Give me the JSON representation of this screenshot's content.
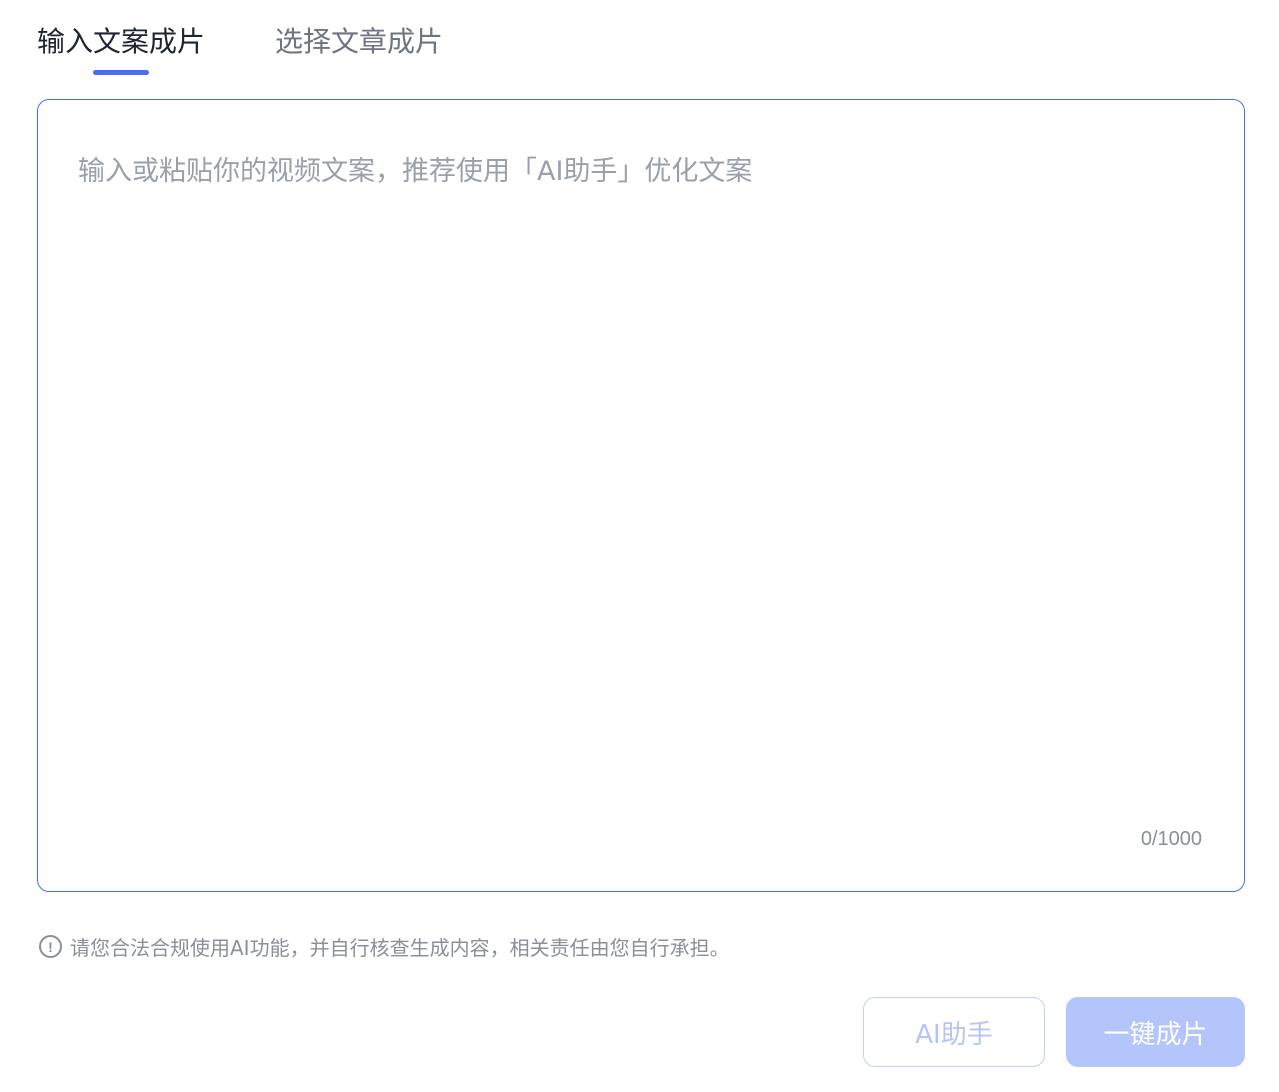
{
  "tabs": [
    {
      "label": "输入文案成片",
      "active": true
    },
    {
      "label": "选择文章成片",
      "active": false
    }
  ],
  "editor": {
    "placeholder": "输入或粘贴你的视频文案，推荐使用「AI助手」优化文案",
    "value": "",
    "counter": "0/1000"
  },
  "notice": {
    "icon": "info-icon",
    "text": "请您合法合规使用AI功能，并自行核查生成内容，相关责任由您自行承担。"
  },
  "buttons": {
    "ai_assistant": "AI助手",
    "generate": "一键成片"
  },
  "colors": {
    "accent": "#4b6bf5",
    "generate_button_bg": "#b4c5fb",
    "ai_button_text": "#b6c4f8"
  }
}
